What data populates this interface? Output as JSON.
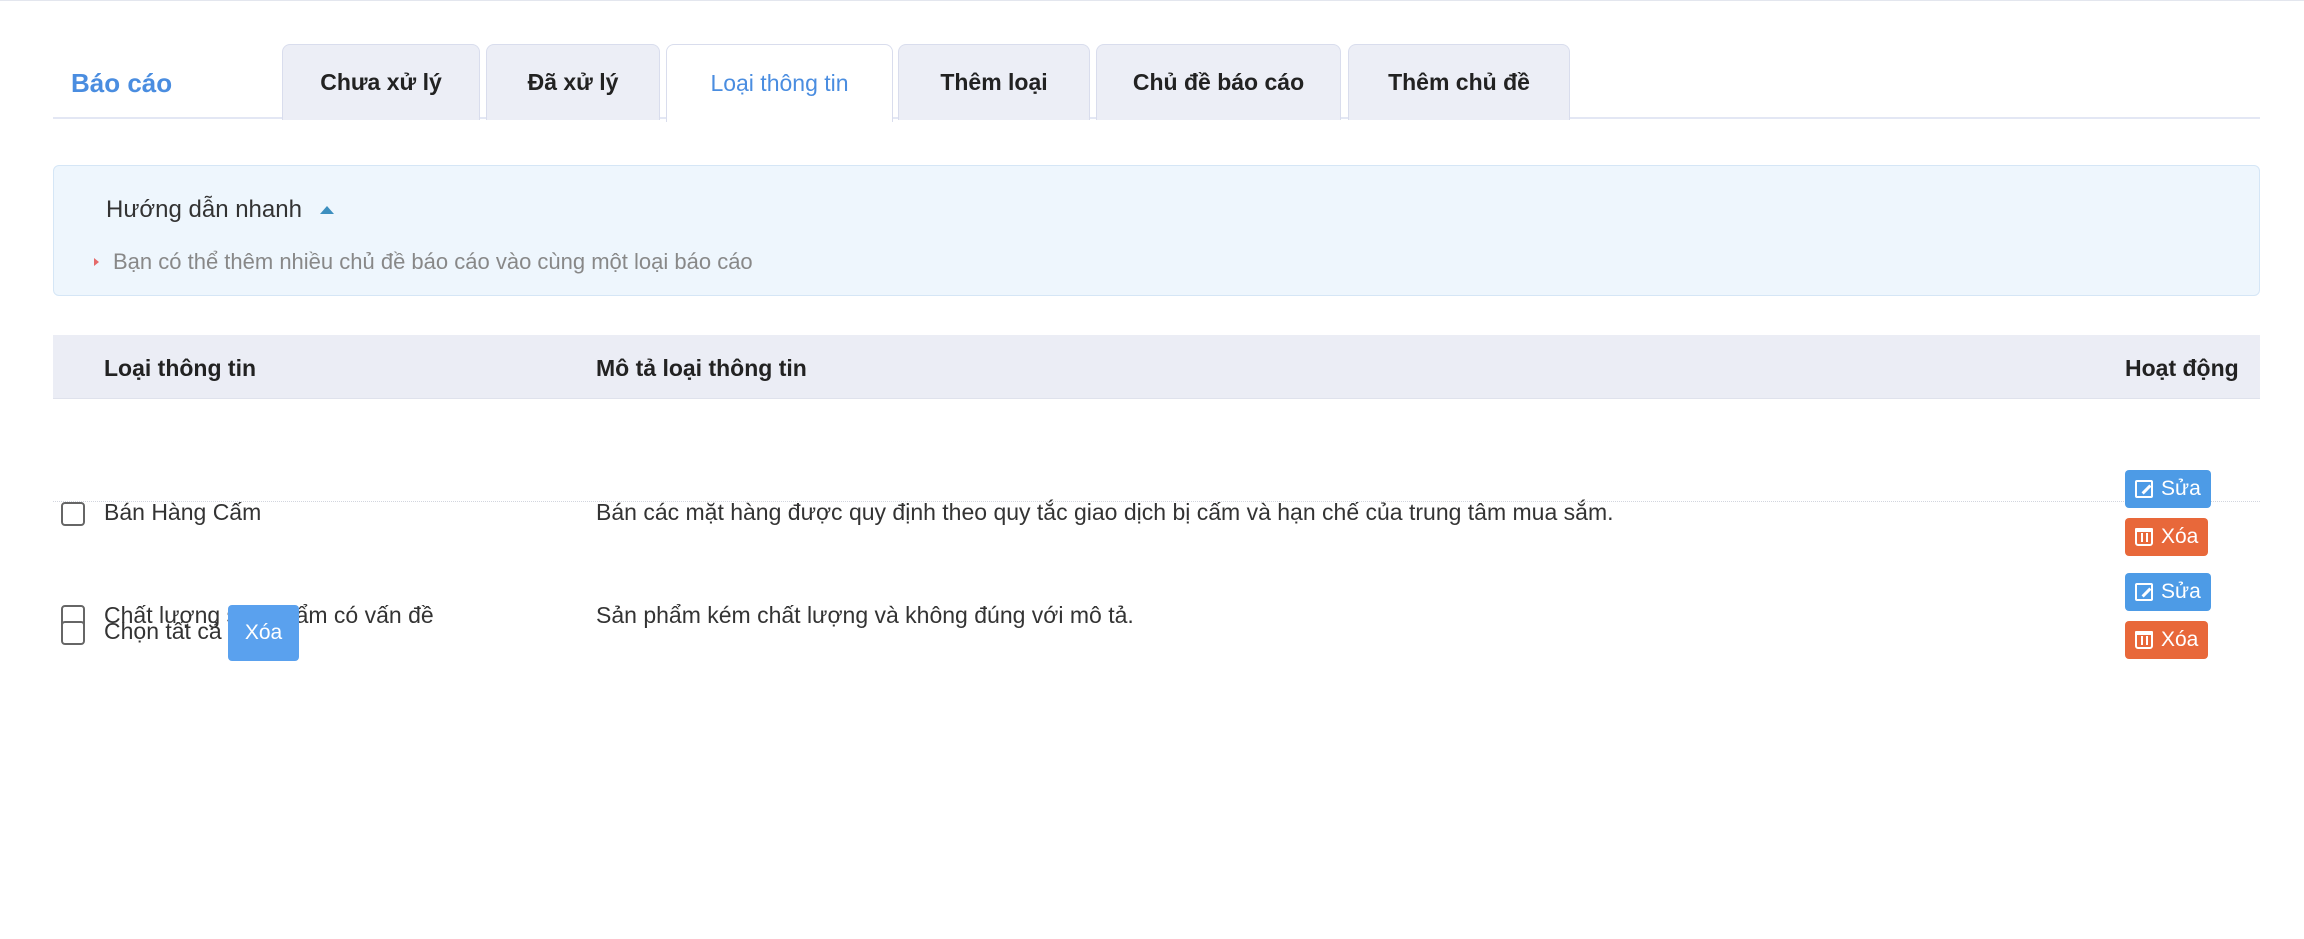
{
  "header": {
    "brand": "Báo cáo",
    "tabs": [
      {
        "label": "Chưa xử lý"
      },
      {
        "label": "Đã xử lý"
      },
      {
        "label": "Loại thông tin"
      },
      {
        "label": "Thêm loại"
      },
      {
        "label": "Chủ đề báo cáo"
      },
      {
        "label": "Thêm chủ đề"
      }
    ],
    "active_tab": "Loại thông tin"
  },
  "guide": {
    "title": "Hướng dẫn nhanh",
    "items": [
      "Bạn có thể thêm nhiều chủ đề báo cáo vào cùng một loại báo cáo"
    ]
  },
  "table": {
    "columns": [
      "Loại thông tin",
      "Mô tả loại thông tin",
      "Hoạt động"
    ],
    "rows": [
      {
        "name": "Bán Hàng Cấm",
        "description": "Bán các mặt hàng được quy định theo quy tắc giao dịch bị cấm và hạn chế của trung tâm mua sắm.",
        "edit_label": "Sửa",
        "delete_label": "Xóa"
      },
      {
        "name": "Chất lượng sản phẩm có vấn đề",
        "description": "Sản phẩm kém chất lượng và không đúng với mô tả.",
        "edit_label": "Sửa",
        "delete_label": "Xóa"
      }
    ]
  },
  "footer": {
    "select_all_label": "Chọn tất cả",
    "bulk_delete_label": "Xóa"
  },
  "colors": {
    "accent": "#4a8de0",
    "edit_button": "#4d9be6",
    "delete_button": "#e8683a",
    "guide_background": "#eef6fd"
  },
  "icons": [
    "caret-up-icon",
    "edit-icon",
    "trash-icon"
  ]
}
